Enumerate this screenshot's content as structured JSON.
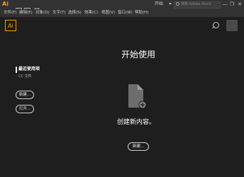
{
  "titlebar": {
    "app_icon": "Ai",
    "workspace": "开始",
    "search_stock_placeholder": "搜索 Adobe Stock",
    "window_buttons": [
      "—",
      "❐",
      "✕"
    ]
  },
  "menu": [
    "文件(F)",
    "编辑(E)",
    "对象(O)",
    "文字(T)",
    "选择(S)",
    "效果(C)",
    "视图(V)",
    "窗口(W)",
    "帮助(H)"
  ],
  "app": {
    "logo": "Ai"
  },
  "sidebar": {
    "recent_label": "最近使用项",
    "cc_label": "CC 文件",
    "new_button": "新建...",
    "open_button": "打开..."
  },
  "main": {
    "title": "开始使用",
    "create_text": "创建新内容。",
    "new_button": "新建..."
  },
  "colors": {
    "accent": "#ff9a00",
    "background": "#1e1e1e"
  }
}
